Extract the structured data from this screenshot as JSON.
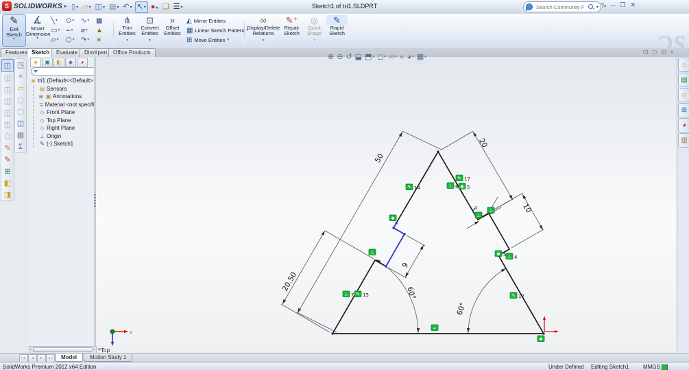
{
  "titlebar": {
    "app_name": "SOLIDWORKS",
    "doc_title": "Sketch1 of tri1.SLDPRT",
    "search_placeholder": "Search Community Forum"
  },
  "ribbon": {
    "exit_sketch": "Exit Sketch",
    "smart_dimension": "Smart Dimension",
    "trim_entities": "Trim Entities",
    "convert_entities": "Convert Entities",
    "offset_entities": "Offset Entities",
    "mirror_entities": "Mirror Entities",
    "linear_sketch_pattern": "Linear Sketch Pattern",
    "move_entities": "Move Entities",
    "display_delete_relations": "Display/Delete Relations",
    "repair_sketch": "Repair Sketch",
    "quick_snaps": "Quick Snaps",
    "rapid_sketch": "Rapid Sketch"
  },
  "command_tabs": [
    {
      "label": "Features"
    },
    {
      "label": "Sketch"
    },
    {
      "label": "Evaluate"
    },
    {
      "label": "DimXpert"
    },
    {
      "label": "Office Products"
    }
  ],
  "feature_tree": {
    "root": "tri1 (Default<<Default>",
    "items": [
      "Sensors",
      "Annotations",
      "Material <not specifie",
      "Front Plane",
      "Top Plane",
      "Right Plane",
      "Origin",
      "(-) Sketch1"
    ]
  },
  "sketch": {
    "dims": {
      "d50": "50",
      "d20_50": "20.50",
      "d9": "9",
      "d20": "20",
      "d3": "3",
      "d10": "10",
      "angle_left": "60°",
      "angle_right": "60°"
    },
    "badges": [
      {
        "glyph": "✎",
        "label": "14"
      },
      {
        "glyph": "✎",
        "label": "17"
      },
      {
        "glyph": "⊥",
        "label": "6"
      },
      {
        "glyph": "◆",
        "label": "5"
      },
      {
        "glyph": "◆",
        "label": ""
      },
      {
        "glyph": "⊥",
        "label": ""
      },
      {
        "glyph": "⊥",
        "label": "7"
      },
      {
        "glyph": "✎",
        "label": "15"
      },
      {
        "glyph": "⊥",
        "label": ""
      },
      {
        "glyph": "⊥",
        "label": ""
      },
      {
        "glyph": "◆",
        "label": "5"
      },
      {
        "glyph": "⊥",
        "label": "4"
      },
      {
        "glyph": "✎",
        "label": "17"
      },
      {
        "glyph": "=",
        "label": ""
      },
      {
        "glyph": "◆",
        "label": ""
      }
    ],
    "triad_label": "*Top",
    "axis_x": "x"
  },
  "bottom_tabs": {
    "model": "Model",
    "motion": "Motion Study 1"
  },
  "statusbar": {
    "edition": "SolidWorks Premium 2012 x64 Edition",
    "state": "Under Defined",
    "mode": "Editing Sketch1",
    "units": "MMGS"
  }
}
